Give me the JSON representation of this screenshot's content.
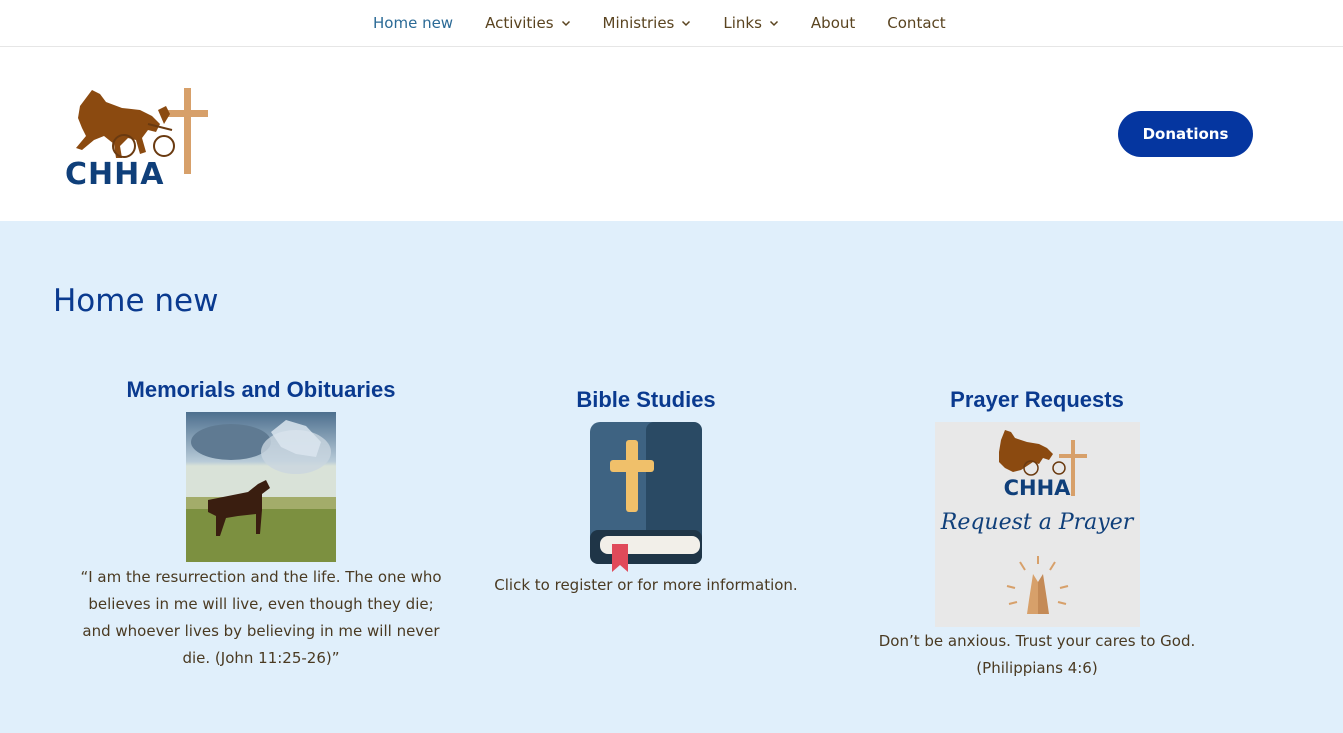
{
  "nav": {
    "items": [
      {
        "label": "Home new",
        "has_dropdown": false,
        "active": true
      },
      {
        "label": "Activities",
        "has_dropdown": true,
        "active": false
      },
      {
        "label": "Ministries",
        "has_dropdown": true,
        "active": false
      },
      {
        "label": "Links",
        "has_dropdown": true,
        "active": false
      },
      {
        "label": "About",
        "has_dropdown": false,
        "active": false
      },
      {
        "label": "Contact",
        "has_dropdown": false,
        "active": false
      }
    ]
  },
  "header": {
    "logo_text": "CHHA",
    "donate_label": "Donations"
  },
  "main": {
    "title": "Home new",
    "columns": [
      {
        "heading": "Memorials and Obituaries",
        "text": "“I am the resurrection and the life. The one who believes in me will live, even though they die; and whoever lives by believing in me will never die. (John 11:25-26)”"
      },
      {
        "heading": "Bible Studies",
        "text": "Click to register or for more information."
      },
      {
        "heading": "Prayer Requests",
        "image_logo_text": "CHHA",
        "image_script_text": "Request a Prayer",
        "text": "Don’t be anxious. Trust your cares to God. (Philippians 4:6)"
      }
    ]
  },
  "colors": {
    "brand_blue": "#0536a0",
    "heading_blue": "#0a3a8f",
    "background": "#e0effb",
    "horse_brown": "#8b4a10",
    "cross_tan": "#d7a06a"
  }
}
